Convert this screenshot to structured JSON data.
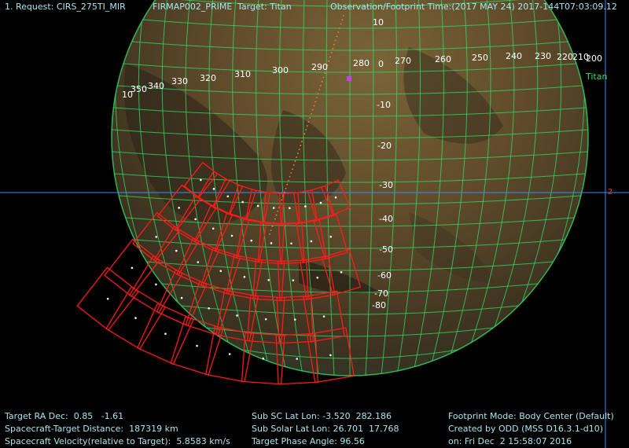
{
  "header": {
    "request": "1. Request: CIRS_275TI_MIR",
    "request_mid": "FIRMAP002_PRIME",
    "target": "Target: Titan",
    "observation_time": "Observation/Footprint Time:(2017 MAY 24) 2017-144T07:03:09.12"
  },
  "body_label": "Titan",
  "edge_marker": "2",
  "lon_labels": [
    "10",
    "350",
    "340",
    "330",
    "320",
    "310",
    "300",
    "290",
    "280",
    "270",
    "260",
    "250",
    "240",
    "230",
    "220",
    "210",
    "200"
  ],
  "lat_labels": [
    "10",
    "0",
    "-10",
    "-20",
    "-30",
    "-40",
    "-50",
    "-60",
    "-70",
    "-80"
  ],
  "colors": {
    "globe_grid": "#2fe06a",
    "footprint": "#ff1a1a",
    "crosshair": "#3a8cff",
    "marker": "#c040ff",
    "hud_text": "#a8e6ee"
  },
  "footer": {
    "ra_dec": "Target RA Dec:  0.85   -1.61",
    "distance": "Spacecraft-Target Distance:  187319 km",
    "velocity": "Spacecraft Velocity(relative to Target):  5.8583 km/s",
    "sub_sc": "Sub SC Lat Lon: -3.520  282.186",
    "sub_solar": "Sub Solar Lat Lon: 26.701  17.768",
    "phase": "Target Phase Angle: 96.56",
    "mode": "Footprint Mode: Body Center (Default)",
    "created_by": "Created by ODD (MSS D16.3.1-d10)",
    "created_on": "on: Fri Dec  2 15:58:07 2016"
  }
}
